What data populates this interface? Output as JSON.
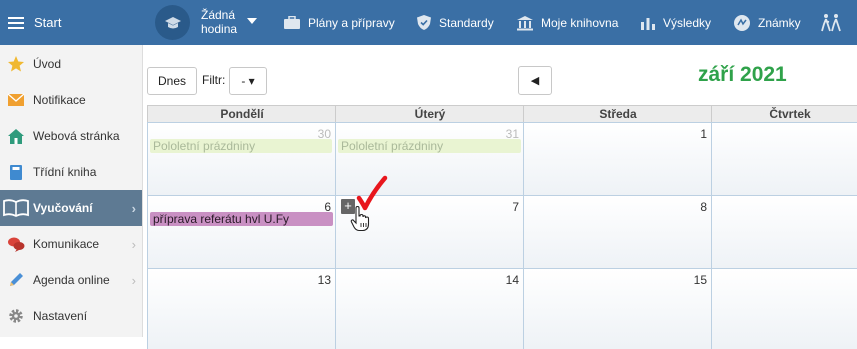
{
  "topbar": {
    "start_label": "Start",
    "lesson_label": "Žádná\nhodina",
    "lesson_line1": "Žádná",
    "lesson_line2": "hodina",
    "nav": [
      {
        "label": "Plány a přípravy",
        "icon": "briefcase-icon"
      },
      {
        "label": "Standardy",
        "icon": "shield-icon"
      },
      {
        "label": "Moje knihovna",
        "icon": "library-icon"
      },
      {
        "label": "Výsledky",
        "icon": "bar-chart-icon"
      },
      {
        "label": "Známky",
        "icon": "grade-icon"
      }
    ],
    "color": "#3a6fa5"
  },
  "sidebar": {
    "items": [
      {
        "label": "Úvod",
        "icon": "star-icon"
      },
      {
        "label": "Notifikace",
        "icon": "envelope-icon"
      },
      {
        "label": "Webová stránka",
        "icon": "house-icon"
      },
      {
        "label": "Třídní kniha",
        "icon": "book-icon"
      },
      {
        "label": "Vyučování",
        "icon": "open-book-icon",
        "active": true
      },
      {
        "label": "Komunikace",
        "icon": "chat-icon"
      },
      {
        "label": "Agenda online",
        "icon": "pencil-icon"
      },
      {
        "label": "Nastavení",
        "icon": "gear-icon"
      }
    ]
  },
  "toolbar": {
    "today_label": "Dnes",
    "filter_label": "Filtr:",
    "filter_value": "- ▾",
    "prev_label": "◀",
    "month_title": "září 2021",
    "month_color": "#2fa24a"
  },
  "calendar": {
    "weekdays": [
      "Pondělí",
      "Úterý",
      "Středa",
      "Čtvrtek"
    ],
    "rows": [
      {
        "days": [
          "30",
          "31",
          "1",
          ""
        ]
      },
      {
        "days": [
          "6",
          "7",
          "8",
          ""
        ]
      },
      {
        "days": [
          "13",
          "14",
          "15",
          ""
        ]
      }
    ],
    "events": {
      "holiday_mon": "Pololetní prázdniny",
      "holiday_tue": "Pololetní prázdniny",
      "task_mon": "příprava referátu hvl U.Fy"
    },
    "add_label": "+"
  }
}
